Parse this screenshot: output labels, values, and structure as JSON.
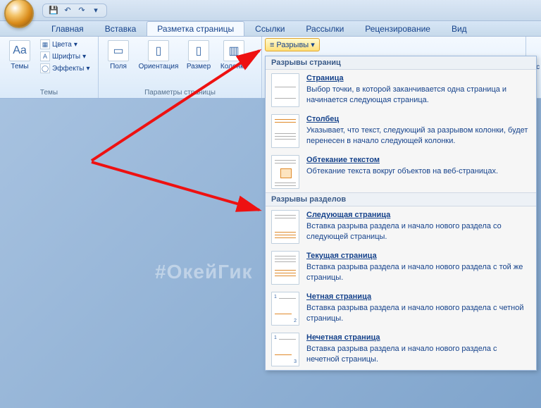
{
  "qat": {
    "save": "💾",
    "undo": "↶",
    "redo": "↷",
    "more": "▾"
  },
  "tabs": {
    "home": "Главная",
    "insert": "Вставка",
    "layout": "Разметка страницы",
    "references": "Ссылки",
    "mailings": "Рассылки",
    "review": "Рецензирование",
    "view": "Вид"
  },
  "ribbon": {
    "themes": {
      "btn": "Темы",
      "colors": "Цвета",
      "fonts": "Шрифты",
      "effects": "Эффекты",
      "group": "Темы"
    },
    "page_setup": {
      "margins": "Поля",
      "orientation": "Ориентация",
      "size": "Размер",
      "columns": "Колонки",
      "group": "Параметры страницы"
    },
    "breaks_btn": "Разрывы",
    "farright": "Отс"
  },
  "menu": {
    "section_pages": "Разрывы страниц",
    "page": {
      "title": "Страница",
      "desc": "Выбор точки, в которой заканчивается одна страница и начинается следующая страница."
    },
    "column": {
      "title": "Столбец",
      "desc": "Указывает, что текст, следующий за разрывом колонки, будет перенесен в начало следующей колонки."
    },
    "textwrap": {
      "title": "Обтекание текстом",
      "desc": "Обтекание текста вокруг объектов на веб-страницах."
    },
    "section_sections": "Разрывы разделов",
    "nextpage": {
      "title": "Следующая страница",
      "desc": "Вставка разрыва раздела и начало нового раздела со следующей страницы."
    },
    "continuous": {
      "title": "Текущая страница",
      "desc": "Вставка разрыва раздела и начало нового раздела с той же страницы."
    },
    "even": {
      "title": "Четная страница",
      "desc": "Вставка разрыва раздела и начало нового раздела с четной страницы."
    },
    "odd": {
      "title": "Нечетная страница",
      "desc": "Вставка разрыва раздела и начало нового раздела с нечетной страницы."
    }
  },
  "watermark": "#ОкейГик"
}
